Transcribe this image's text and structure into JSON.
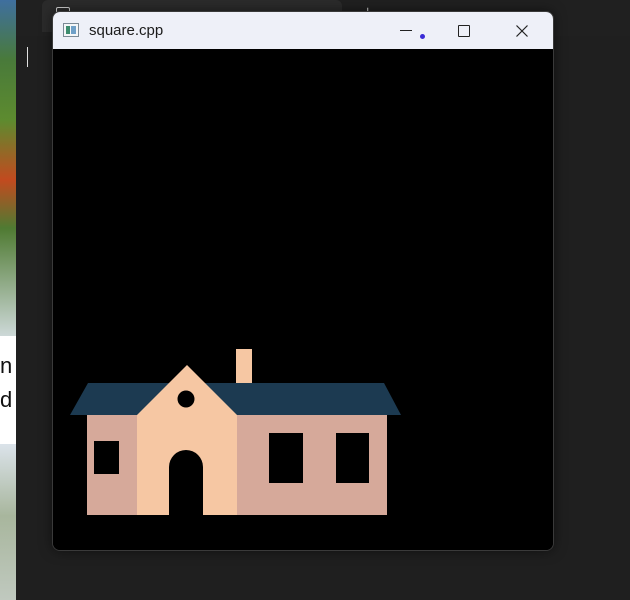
{
  "window": {
    "title": "square.cpp",
    "controls": {
      "minimize_icon": "minimize-icon",
      "maximize_icon": "maximize-icon",
      "close_icon": "close-icon"
    }
  },
  "background": {
    "card_text": [
      "n",
      "d"
    ]
  },
  "scene": {
    "description_colors": {
      "roof": "#1c3a51",
      "wall": "#d6a99a",
      "gable": "#f6c7a3",
      "chimney": "#f6c7a3",
      "openings": "#000000",
      "canvas": "#000000"
    }
  }
}
